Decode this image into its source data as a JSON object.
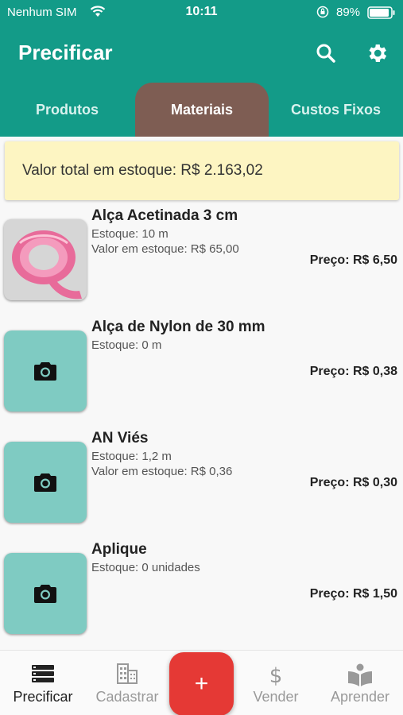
{
  "status_bar": {
    "carrier": "Nenhum SIM",
    "time": "10:11",
    "battery": "89%"
  },
  "header": {
    "title": "Precificar",
    "actions": [
      {
        "icon": "search-icon"
      },
      {
        "icon": "gear-icon"
      }
    ]
  },
  "tabs": [
    {
      "label": "Produtos",
      "selected": false
    },
    {
      "label": "Materiais",
      "selected": true
    },
    {
      "label": "Custos Fixos",
      "selected": false
    }
  ],
  "summary": {
    "text": "Valor total em estoque: R$ 2.163,02"
  },
  "materials": [
    {
      "name": "Alça Acetinada 3 cm",
      "stock": "Estoque: 10 m",
      "stock_value": "Valor em estoque: R$ 65,00",
      "price": "Preço: R$ 6,50",
      "thumbnail": "photo"
    },
    {
      "name": "Alça de Nylon de 30 mm",
      "stock": "Estoque: 0 m",
      "stock_value": "",
      "price": "Preço: R$ 0,38",
      "thumbnail": "camera-icon"
    },
    {
      "name": "AN Viés",
      "stock": "Estoque: 1,2 m",
      "stock_value": "Valor em estoque: R$ 0,36",
      "price": "Preço: R$ 0,30",
      "thumbnail": "camera-icon"
    },
    {
      "name": "Aplique",
      "stock": "Estoque: 0 unidades",
      "stock_value": "",
      "price": "Preço: R$ 1,50",
      "thumbnail": "camera-icon"
    }
  ],
  "bottom_nav": {
    "items": [
      {
        "label": "Precificar",
        "icon": "list-icon",
        "active": true
      },
      {
        "label": "Cadastrar",
        "icon": "building-icon",
        "active": false
      },
      {
        "label": "Vender",
        "icon": "dollar-icon",
        "active": false
      },
      {
        "label": "Aprender",
        "icon": "reader-icon",
        "active": false
      }
    ],
    "fab_label": "+"
  },
  "colors": {
    "primary": "#139b88",
    "tab_selected": "#7e5d53",
    "summary_bg": "#fdf5c2",
    "thumb_bg": "#7fcbc2",
    "fab": "#e53935"
  }
}
